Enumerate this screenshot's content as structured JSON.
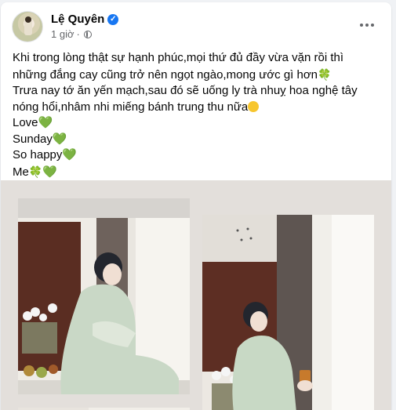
{
  "post": {
    "author": "Lệ Quyên",
    "time": "1 giờ",
    "verified_icon": "check-icon",
    "privacy_icon": "globe-icon",
    "options_icon": "more-horizontal-icon",
    "lines": [
      "Khi trong lòng thật sự hạnh phúc,mọi thứ đủ đầy vừa vặn rồi thì",
      "những đắng cay cũng trở nên ngọt ngào,mong ước gì hơn",
      "Trưa nay tớ ăn yến mạch,sau đó sẽ uống ly trà nhuỵ hoa nghệ tây",
      "nóng hổi,nhâm nhi miếng bánh trung thu nữa",
      "Love",
      "Sunday",
      "So happy",
      "Me"
    ],
    "emojis": {
      "clover": "🍀",
      "heart": "💚",
      "smile": "😉"
    }
  },
  "colors": {
    "accent": "#1877f2",
    "text": "#050505",
    "meta": "#65676b",
    "photo_background": "#e3dfdb"
  }
}
